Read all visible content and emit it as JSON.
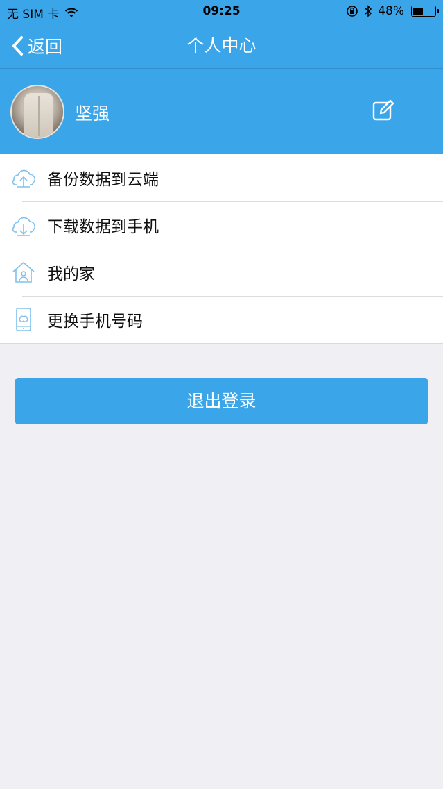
{
  "status_bar": {
    "carrier": "无 SIM 卡",
    "time": "09:25",
    "battery": "48%",
    "battery_level": 0.48
  },
  "nav": {
    "back_label": "返回",
    "title": "个人中心"
  },
  "profile": {
    "username": "坚强"
  },
  "menu": {
    "items": [
      {
        "label": "备份数据到云端",
        "icon": "cloud-upload-icon"
      },
      {
        "label": "下载数据到手机",
        "icon": "cloud-download-icon"
      },
      {
        "label": "我的家",
        "icon": "home-icon"
      },
      {
        "label": "更换手机号码",
        "icon": "phone-icon"
      }
    ]
  },
  "logout": {
    "label": "退出登录"
  },
  "colors": {
    "primary": "#3ba5e9",
    "background": "#efeff4",
    "icon_stroke": "#7fc0ec"
  }
}
